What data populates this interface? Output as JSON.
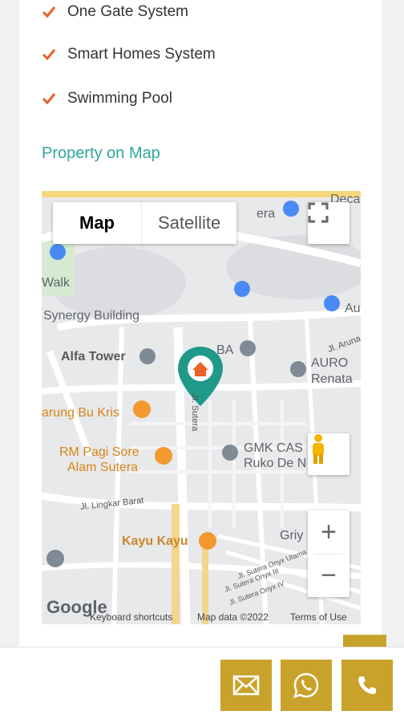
{
  "features": [
    {
      "label": "One Gate System"
    },
    {
      "label": "Smart Homes System"
    },
    {
      "label": "Swimming Pool"
    }
  ],
  "section_title": "Property on Map",
  "map": {
    "type_control": {
      "map": "Map",
      "satellite": "Satellite"
    },
    "labels": {
      "walk": "Walk",
      "synergy": "Synergy Building",
      "alfa": "Alfa Tower",
      "ba": "BA",
      "aurora1": "AURO",
      "aurora2": "Renata",
      "warung": "arung Bu Kris",
      "rm1": "RM Pagi Sore",
      "rm2": "Alam Sutera",
      "gmk1": "GMK CAS",
      "gmk2": "Ruko De N",
      "lingkar": "Jl. Lingkar Barat",
      "kayu": "Kayu Kayu",
      "griy": "Griy",
      "sutera": "Jl. Sutera",
      "era": "era",
      "deca": "Deca",
      "au": "Au",
      "aruna": "Jl. Aruna",
      "onyx1": "Jl. Sutera Onyx Utama",
      "onyx2": "Jl. Sutera Onyx III",
      "onyx3": "Jl. Sutera Onyx IV"
    },
    "zoom_in": "+",
    "zoom_out": "−",
    "google": "Google",
    "keyboard": "Keyboard shortcuts",
    "map_data": "Map data ©2022",
    "terms": "Terms of Use"
  },
  "colors": {
    "accent": "#c9a22b",
    "title": "#2ea79a",
    "check": "#e8622a",
    "marker": "#1f9a88"
  }
}
